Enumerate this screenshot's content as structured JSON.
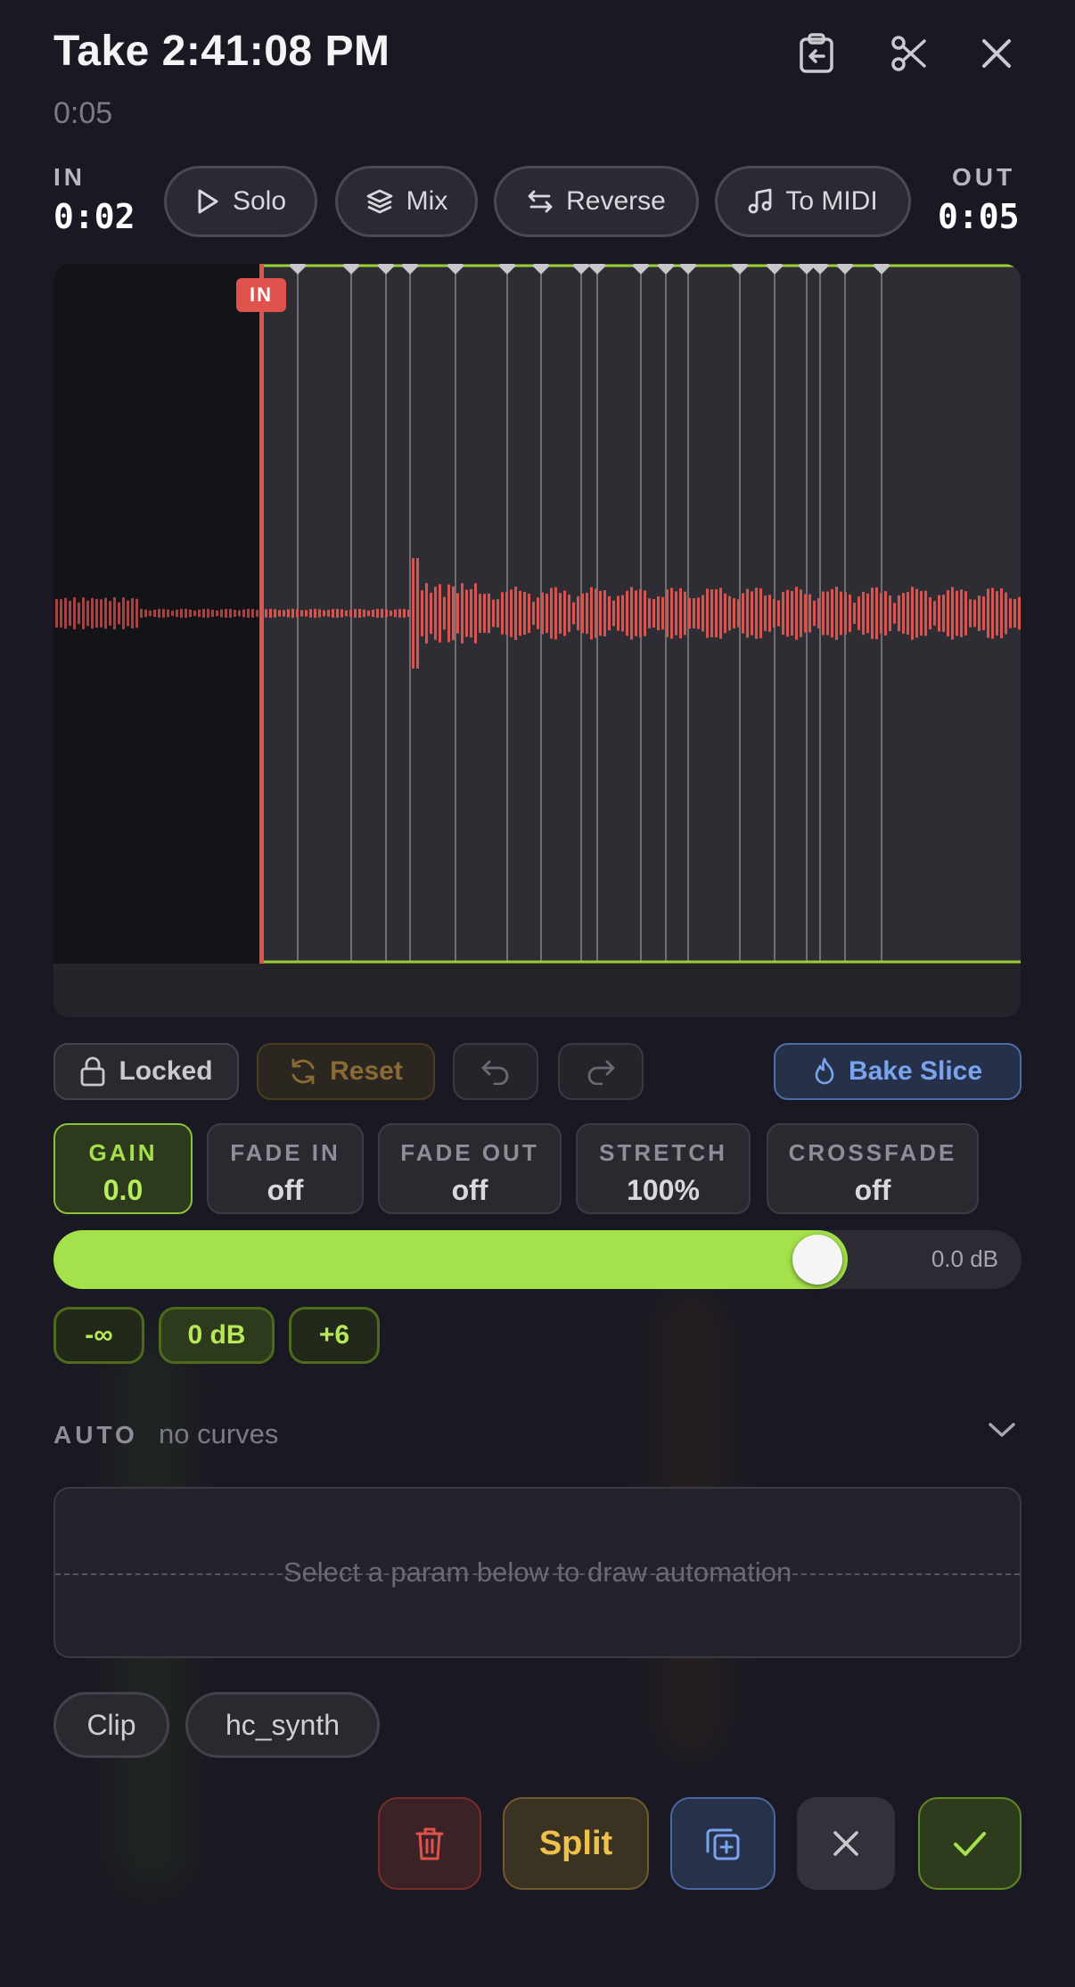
{
  "header": {
    "title": "Take 2:41:08 PM",
    "duration": "0:05"
  },
  "transport": {
    "in_label": "IN",
    "in_time": "0:02",
    "out_label": "OUT",
    "out_time": "0:05",
    "buttons": [
      {
        "label": "Solo",
        "icon": "play-icon"
      },
      {
        "label": "Mix",
        "icon": "layers-icon"
      },
      {
        "label": "Reverse",
        "icon": "swap-arrows-icon"
      },
      {
        "label": "To MIDI",
        "icon": "music-note-icon"
      }
    ]
  },
  "waveform": {
    "in_marker_label": "IN",
    "in_position_fraction": 0.215,
    "colors": {
      "wave": "#d9534f",
      "marker": "#e0524c",
      "envelope": "#9acd32"
    }
  },
  "edit_toolbar": {
    "locked_label": "Locked",
    "reset_label": "Reset",
    "bake_label": "Bake Slice"
  },
  "params": [
    {
      "name": "GAIN",
      "value": "0.0",
      "active": true
    },
    {
      "name": "FADE IN",
      "value": "off"
    },
    {
      "name": "FADE OUT",
      "value": "off"
    },
    {
      "name": "STRETCH",
      "value": "100%"
    },
    {
      "name": "CROSSFADE",
      "value": "off"
    }
  ],
  "gain_slider": {
    "value_label": "0.0 dB",
    "fill_fraction": 0.82
  },
  "quick_values": [
    "-∞",
    "0 dB",
    "+6"
  ],
  "automation": {
    "label": "AUTO",
    "status": "no curves",
    "placeholder": "Select a param below to draw automation"
  },
  "tags": [
    "Clip",
    "hc_synth"
  ],
  "actions": {
    "split_label": "Split"
  },
  "colors": {
    "accent_green": "#a4e14a",
    "danger_red": "#e0524c",
    "gold": "#e8b94a",
    "blue": "#6f9ae0"
  }
}
